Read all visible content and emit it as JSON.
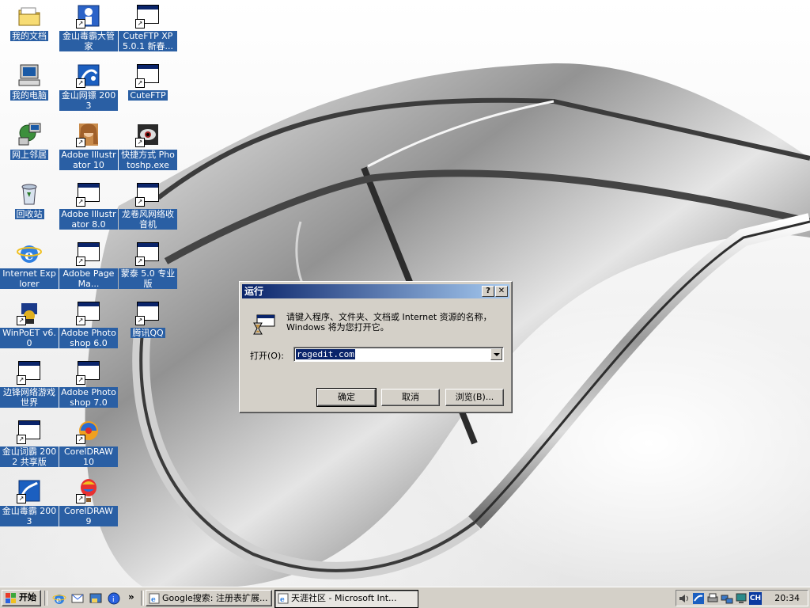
{
  "desktop": {
    "icons": [
      {
        "label": "我的文档",
        "name": "my-documents-icon"
      },
      {
        "label": "金山毒霸大管家",
        "name": "kingsoft-antivirus-manager-icon"
      },
      {
        "label": "CuteFTP XP 5.0.1 新春...",
        "name": "cuteftp-xp-icon"
      },
      {
        "label": "我的电脑",
        "name": "my-computer-icon"
      },
      {
        "label": "金山网镖 2003",
        "name": "kingsoft-firewall-icon"
      },
      {
        "label": "CuteFTP",
        "name": "cuteftp-icon"
      },
      {
        "label": "网上邻居",
        "name": "network-places-icon"
      },
      {
        "label": "Adobe Illustrator 10",
        "name": "illustrator-10-icon"
      },
      {
        "label": "快捷方式 Photoshp.exe",
        "name": "photoshop-shortcut-icon"
      },
      {
        "label": "回收站",
        "name": "recycle-bin-icon"
      },
      {
        "label": "Adobe Illustrator 8.0",
        "name": "illustrator-8-icon"
      },
      {
        "label": "龙卷风网络收音机",
        "name": "tornado-radio-icon"
      },
      {
        "label": "Internet Explorer",
        "name": "internet-explorer-icon"
      },
      {
        "label": "Adobe PageMa...",
        "name": "pagemaker-icon"
      },
      {
        "label": "蒙泰 5.0 专业版",
        "name": "mengtai-icon"
      },
      {
        "label": "WinPoET v6.0",
        "name": "winpoet-icon"
      },
      {
        "label": "Adobe Photoshop 6.0",
        "name": "photoshop-6-icon"
      },
      {
        "label": "腾讯QQ",
        "name": "tencent-qq-icon"
      },
      {
        "label": "边锋网络游戏世界",
        "name": "bianfeng-games-icon"
      },
      {
        "label": "Adobe Photoshop 7.0",
        "name": "photoshop-7-icon"
      },
      {
        "label": "金山词霸 2002 共享版",
        "name": "kingsoft-powerword-icon"
      },
      {
        "label": "CorelDRAW 10",
        "name": "coreldraw-10-icon"
      },
      {
        "label": "金山毒霸 2003",
        "name": "kingsoft-antivirus-icon"
      },
      {
        "label": "CorelDRAW 9",
        "name": "coreldraw-9-icon"
      }
    ]
  },
  "run_dialog": {
    "title": "运行",
    "help_button": "?",
    "close_button": "✕",
    "prompt": "请键入程序、文件夹、文档或 Internet 资源的名称，Windows 将为您打开它。",
    "open_label": "打开(O):",
    "open_value": "regedit.com",
    "ok_label": "确定",
    "cancel_label": "取消",
    "browse_label": "浏览(B)..."
  },
  "taskbar": {
    "start_label": "开始",
    "overflow": "»",
    "tasks": [
      {
        "label": "Google搜索: 注册表扩展..."
      },
      {
        "label": "天涯社区 - Microsoft Int..."
      }
    ],
    "tray_lang": "CH",
    "clock": "20:34"
  },
  "colors": {
    "desktop_label_bg": "#2a5fa4",
    "title_bar_start": "#0a246a",
    "title_bar_end": "#a6caf0",
    "face": "#d4d0c8"
  }
}
